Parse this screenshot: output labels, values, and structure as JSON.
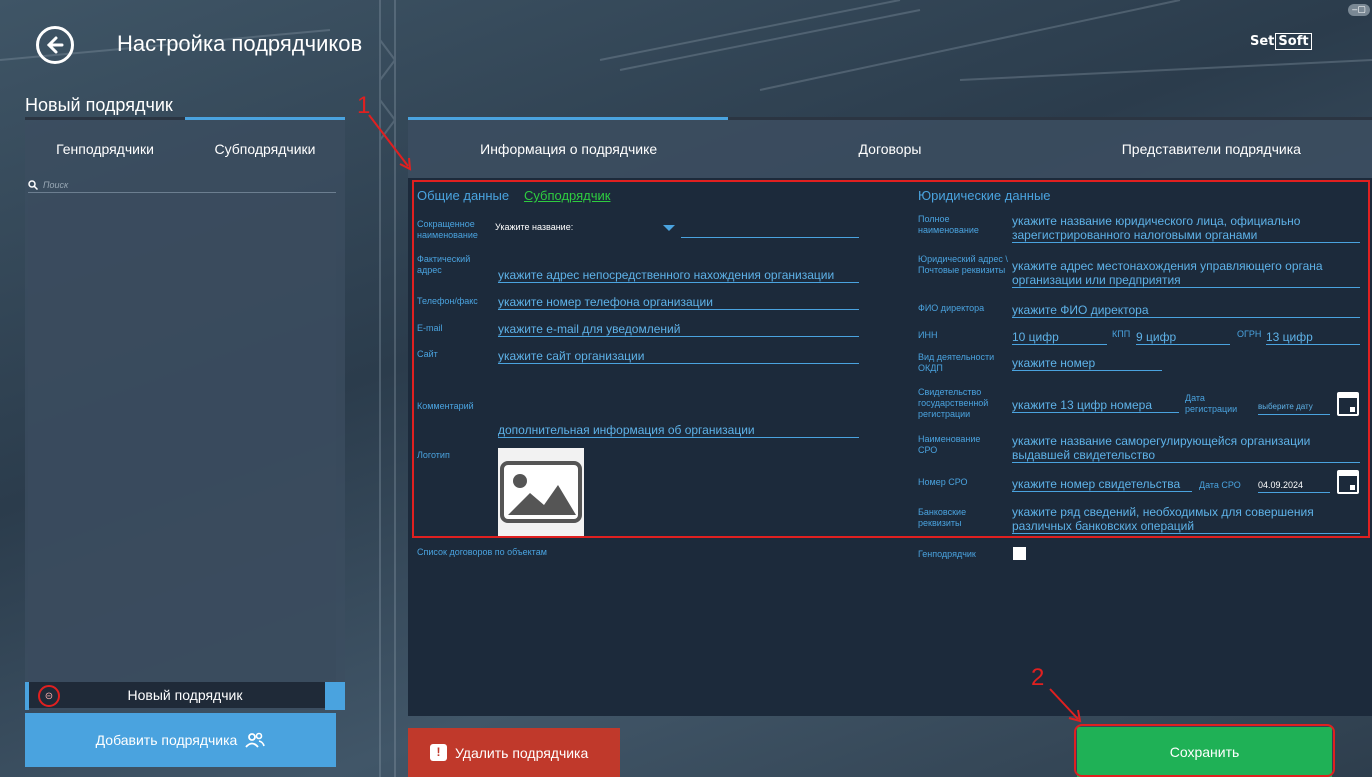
{
  "header": {
    "title": "Настройка подрядчиков",
    "logo_text": "Set",
    "logo_box": "Soft"
  },
  "left": {
    "section_title": "Новый подрядчик",
    "tabs": [
      "Генподрядчики",
      "Субподрядчики"
    ],
    "search_placeholder": "Поиск",
    "new_item_label": "Новый подрядчик",
    "add_button": "Добавить подрядчика"
  },
  "main": {
    "tabs": [
      "Информация о подрядчике",
      "Договоры",
      "Представители подрядчика"
    ],
    "general": {
      "title": "Общие данные",
      "type_link": "Субподрядчик",
      "short_name_label": "Сокращенное наименование",
      "short_name_combo": "Укажите название:",
      "address_label": "Фактический адрес",
      "address_value": "укажите адрес непосредственного нахождения организации",
      "phone_label": "Телефон/факс",
      "phone_value": "укажите номер телефона организации",
      "email_label": "E-mail",
      "email_value": "укажите e-mail для уведомлений",
      "site_label": "Сайт",
      "site_value": "укажите сайт организации",
      "comment_label": "Комментарий",
      "comment_value": "дополнительная информация об организации",
      "logo_label": "Логотип",
      "contracts_label": "Список договоров по объектам"
    },
    "legal": {
      "title": "Юридические данные",
      "full_name_label": "Полное наименование",
      "full_name_value": "укажите название юридического лица, официально зарегистрированного налоговыми органами",
      "legal_address_label": "Юридический адрес \\ Почтовые реквизиты",
      "legal_address_value": "укажите адрес местонахождения управляющего органа организации или предприятия",
      "director_label": "ФИО директора",
      "director_value": "укажите ФИО директора",
      "inn_label": "ИНН",
      "inn_value": "10 цифр",
      "kpp_label": "КПП",
      "kpp_value": "9 цифр",
      "ogrn_label": "ОГРН",
      "ogrn_value": "13 цифр",
      "okdp_label": "Вид деятельности ОКДП",
      "okdp_value": "укажите номер",
      "cert_label": "Свидетельство государственной регистрации",
      "cert_value": "укажите 13 цифр номера",
      "reg_date_label": "Дата регистрации",
      "reg_date_value": "выберите дату",
      "sro_name_label": "Наименование СРО",
      "sro_name_value": "укажите название саморегулирующейся организации выдавшей свидетельство",
      "sro_num_label": "Номер СРО",
      "sro_num_value": "укажите номер свидетельства",
      "sro_date_label": "Дата СРО",
      "sro_date_value": "04.09.2024",
      "bank_label": "Банковские реквизиты",
      "bank_value": "укажите ряд сведений, необходимых для совершения различных банковских операций",
      "gen_label": "Генподрядчик"
    }
  },
  "actions": {
    "delete": "Удалить подрядчика",
    "save": "Сохранить"
  },
  "annotations": [
    "1",
    "2"
  ],
  "colors": {
    "accent": "#4aa3df",
    "save": "#1fb156",
    "delete": "#c0392b",
    "highlight": "#e02020"
  }
}
